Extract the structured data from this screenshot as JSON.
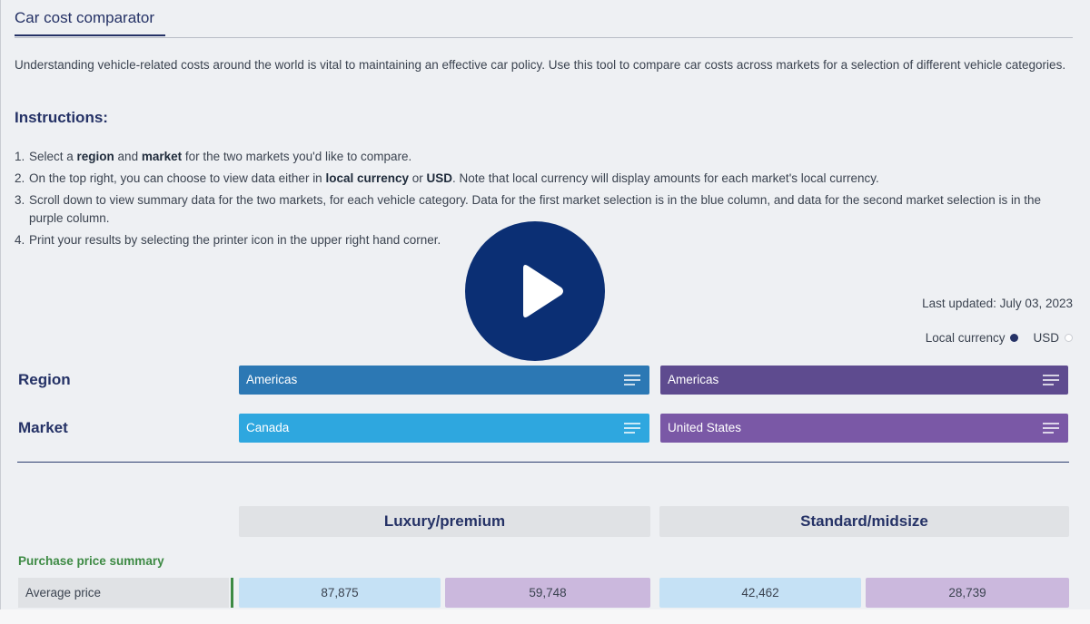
{
  "tab": {
    "title": "Car cost comparator"
  },
  "intro": "Understanding vehicle-related costs around the world is vital to maintaining an effective car policy. Use this tool to compare car costs across markets for a selection of different vehicle categories.",
  "instructions": {
    "heading": "Instructions:",
    "steps": [
      {
        "num": "1.",
        "parts": [
          "Select a ",
          "region",
          " and ",
          "market",
          " for the two markets you'd like to compare."
        ]
      },
      {
        "num": "2.",
        "parts": [
          "On the top right, you can choose to view data either in ",
          "local currency",
          " or ",
          "USD",
          ". Note that local currency will display amounts for each market's local currency."
        ]
      },
      {
        "num": "3.",
        "parts": [
          "Scroll down to view summary data for the two markets, for each vehicle category. Data for the first market selection is in the blue column, and data for the second market selection is in the purple column."
        ]
      },
      {
        "num": "4.",
        "parts": [
          "Print your results by selecting the printer icon in the upper right hand corner."
        ]
      }
    ]
  },
  "video": {
    "icon": "play-icon"
  },
  "last_updated": "Last updated: July 03, 2023",
  "currency": {
    "local_label": "Local currency",
    "usd_label": "USD",
    "selected": "local"
  },
  "selectors": {
    "region_label": "Region",
    "market_label": "Market",
    "region_a": "Americas",
    "region_b": "Americas",
    "market_a": "Canada",
    "market_b": "United States",
    "icon": "menu-lines-icon"
  },
  "categories": [
    "Luxury/premium",
    "Standard/midsize"
  ],
  "summary": {
    "section_label": "Purchase price summary",
    "rows": [
      {
        "name": "Average price",
        "values": [
          "87,875",
          "59,748",
          "42,462",
          "28,739"
        ]
      }
    ]
  },
  "colors": {
    "navy": "#253266",
    "play": "#0b2f74",
    "region_a": "#2c78b4",
    "region_b": "#5e4b8f",
    "market_a": "#2ea7df",
    "market_b": "#7a58a6",
    "cell_blue": "#c5e1f5",
    "cell_purple": "#cbb8dd",
    "section_green": "#3d8a44"
  }
}
